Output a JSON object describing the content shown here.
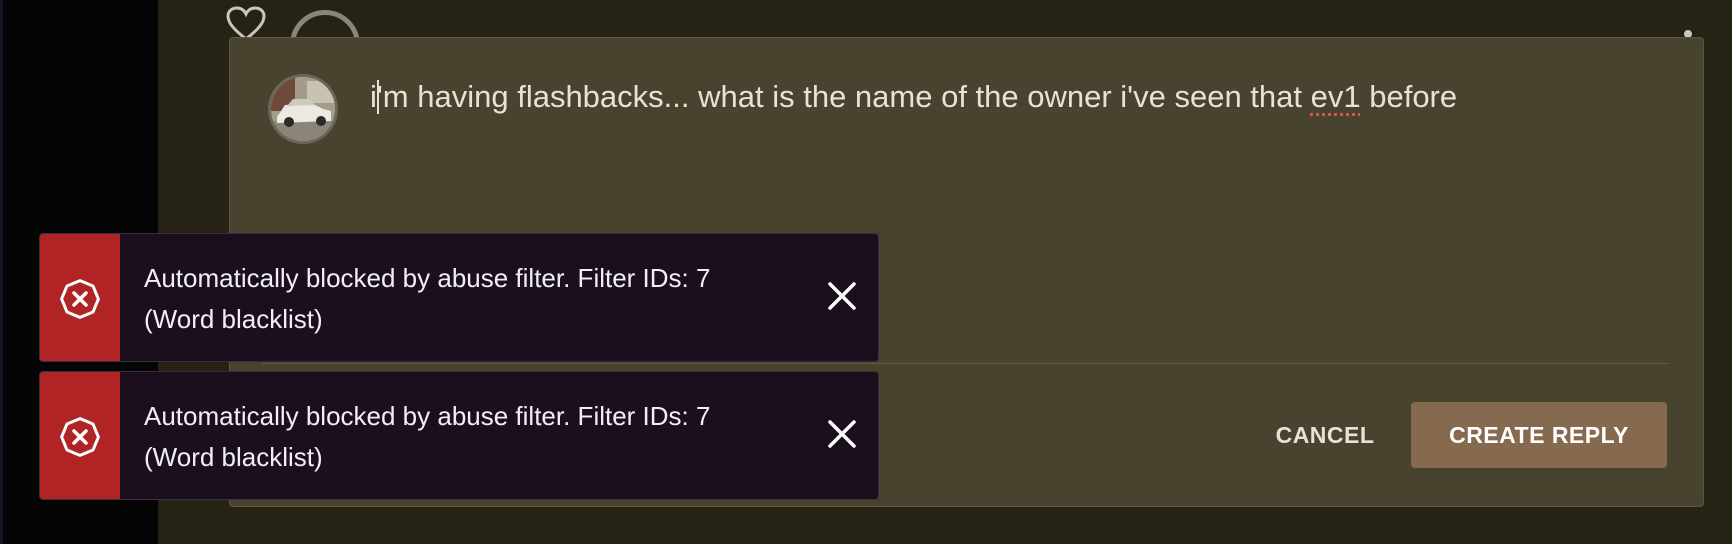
{
  "reply": {
    "text_before_flag": "i'm having flashbacks... what is the name of the owner i've seen that ",
    "flagged_word": "ev1",
    "text_after_flag": " before"
  },
  "actions": {
    "cancel_label": "CANCEL",
    "create_reply_label": "CREATE REPLY"
  },
  "toasts": [
    {
      "message": "Automatically blocked by abuse filter. Filter IDs: 7 (Word blacklist)",
      "icon": "error-circle-x-icon",
      "close_icon": "close-icon"
    },
    {
      "message": "Automatically blocked by abuse filter. Filter IDs: 7 (Word blacklist)",
      "icon": "error-circle-x-icon",
      "close_icon": "close-icon"
    }
  ],
  "colors": {
    "page_background": "#262214",
    "panel_background": "#48432f",
    "primary_button": "#856a4f",
    "toast_background": "#1b0f1e",
    "toast_error_stripe": "#b12425"
  }
}
